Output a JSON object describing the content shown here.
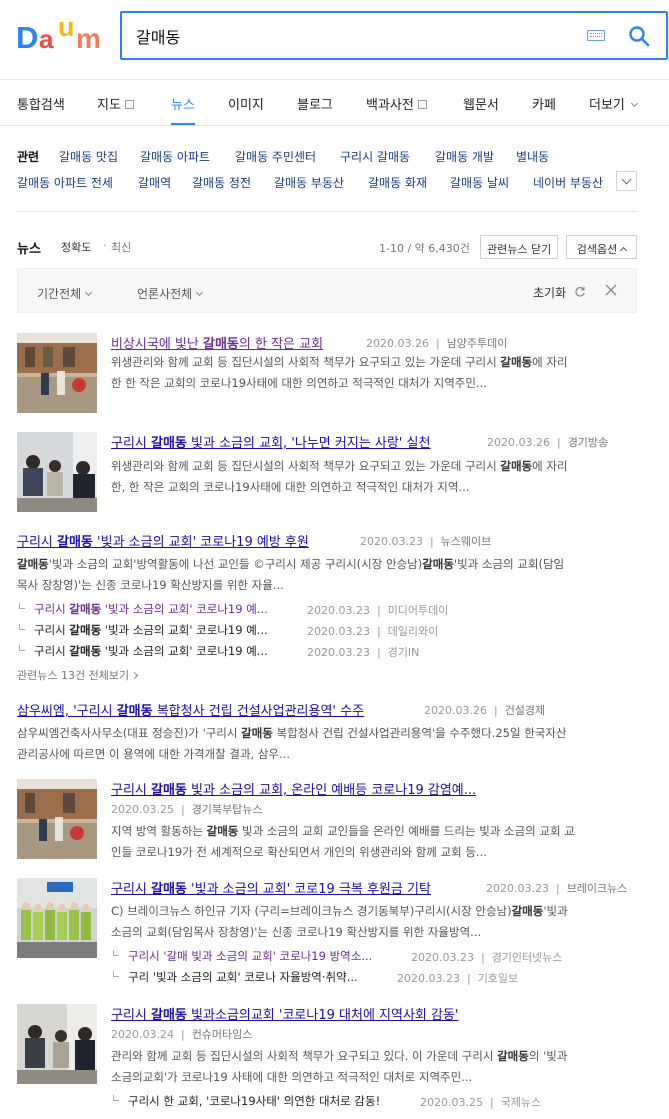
{
  "header": {
    "logo": {
      "letters": [
        "D",
        "a",
        "u",
        "m"
      ],
      "colors": [
        "#2c82f2",
        "#ef4b3f",
        "#f6b81b",
        "#f27c5a"
      ]
    },
    "search": {
      "value": "갈매동",
      "placeholder": ""
    }
  },
  "tabs": [
    {
      "label": "통합검색"
    },
    {
      "label": "지도"
    },
    {
      "label": "뉴스",
      "active": true
    },
    {
      "label": "이미지"
    },
    {
      "label": "블로그"
    },
    {
      "label": "백과사전"
    },
    {
      "label": "웹문서"
    },
    {
      "label": "카페"
    },
    {
      "label": "더보기"
    }
  ],
  "related": {
    "label": "관련",
    "keywords": [
      "갈매동 맛집",
      "갈매동 아파트",
      "갈매동 주민센터",
      "구리시 갈매동",
      "갈매동 개발",
      "별내동",
      "갈매동 아파트 전세",
      "갈매역",
      "갈매동 정전",
      "갈매동 부동산",
      "갈매동 화재",
      "갈매동 날씨",
      "네이버 부동산"
    ]
  },
  "news_head": {
    "title": "뉴스",
    "sort_accuracy": "정확도",
    "sort_dot": "·",
    "sort_recent": "최신",
    "count": "1-10 / 약 6,430건",
    "close_related_btn": "관련뉴스 닫기",
    "search_options_btn": "검색옵션"
  },
  "filter": {
    "period": "기간전체",
    "press": "언론사전체",
    "reset": "초기화"
  },
  "items": [
    {
      "title_pre": "비상시국에 빛난 ",
      "title_kw": "갈매동",
      "title_post": "의 한 작은 교회",
      "date": "2020.03.26",
      "source": "남양주투데이",
      "desc1_pre": "위생관리와 함께 교회 등 집단시설의 사회적 책무가 요구되고 있는 가운데 구리시 ",
      "desc1_kw": "갈매동",
      "desc1_post": "에 자리",
      "desc2": "한 한 작은 교회의 코로나19사태에 대한 의연하고 적극적인 대처가 지역주민..."
    },
    {
      "title_pre": "구리시 ",
      "title_kw": "갈매동",
      "title_post": " 빛과 소금의 교회, '나누면 커지는 사랑' 실천",
      "date": "2020.03.26",
      "source": "경기방송",
      "desc1_pre": "위생관리와 함께 교회 등 집단시설의 사회적 책무가 요구되고 있는 가운데 구리시 ",
      "desc1_kw": "갈매동",
      "desc1_post": "에 자리",
      "desc2": "한, 한 작은 교회의 코로나19사태에 대한 의연하고 적극적인 대처가 지역..."
    },
    {
      "title_pre": "구리시 ",
      "title_kw": "갈매동",
      "title_post": " '빛과 소금의 교회' 코로나19 예방 후원",
      "date": "2020.03.23",
      "source": "뉴스웨이브",
      "desc1_kw0": "갈매동",
      "desc1_pre": "'빛과 소금의 교회'방역활동에 나선 교인들 ©구리시 제공 구리시(시장 안승남)",
      "desc1_kw": "갈매동",
      "desc1_post": "'빛과 소금의 교회(담임",
      "desc2": "목사 장창영)'는 신종 코로나19 확산방지를 위한 자율...",
      "subs": [
        {
          "pre": "구리시 ",
          "kw": "갈매동",
          "post": " '빛과 소금의 교회' 코로나19 예...",
          "date": "2020.03.23",
          "source": "미디어투데이"
        },
        {
          "pre": "구리시 ",
          "kw": "갈매동",
          "post": " '빛과 소금의 교회' 코로나19 예...",
          "date": "2020.03.23",
          "source": "데일리와이"
        },
        {
          "pre": "구리시 ",
          "kw": "갈매동",
          "post": " '빛과 소금의 교회' 코로나19 예...",
          "date": "2020.03.23",
          "source": "경기IN"
        }
      ],
      "related_all": "관련뉴스 13건 전체보기"
    },
    {
      "title_pre": "삼우씨엠, '구리시 ",
      "title_kw": "갈매동",
      "title_post": " 복합청사 건립 건설사업관리용역' 수주",
      "date": "2020.03.26",
      "source": "건설경제",
      "desc1_pre": "삼우씨엠건축사사무소(대표 정승진)가 '구리시 ",
      "desc1_kw": "갈매동",
      "desc1_post": " 복합청사 건립 건설사업관리용역'을 수주했다.25일 한국자산",
      "desc2": "관리공사에 따르면 이 용역에 대한 가격개찰 결과, 삼우..."
    },
    {
      "title_pre": "구리시 ",
      "title_kw": "갈매동",
      "title_post": " 빛과 소금의 교회, 온라인 예배등 코로나19 감염예...",
      "date": "2020.03.25",
      "source": "경기북부탑뉴스",
      "desc1_pre": "지역 방역 활동하는 ",
      "desc1_kw": "갈매동",
      "desc1_post": " 빛과 소금의 교회 교인들을 온라인 예배를 드리는 빛과 소금의 교회 교",
      "desc2": "인들 코로나19가 전 세계적으로 확산되면서 개인의 위생관리와 함께 교회 등..."
    },
    {
      "title_pre": "구리시 ",
      "title_kw": "갈매동",
      "title_post": " '빛과 소금의 교회' 코로19 극복 후원금 기탁",
      "date": "2020.03.23",
      "source": "브레이크뉴스",
      "desc1_pre": "C) 브레이크뉴스 하인규 기자 (구리=브레이크뉴스 경기동북부)구리시(시장 안승남)",
      "desc1_kw": "갈매동",
      "desc1_post": "'빛과",
      "desc2": "소금의 교회(담임목사 장창영)'는 신종 코로나19 확산방지를 위한 자율방역...",
      "subs": [
        {
          "pre": "구리시 '갈매 빛과 소금의 교회' 코로나19 방역소...",
          "kw": "",
          "post": "",
          "date": "2020.03.23",
          "source": "경기인터넷뉴스"
        },
        {
          "pre": "구리 '빛과 소금의 교회' 코로나 자율방역·취약...",
          "kw": "",
          "post": "",
          "date": "2020.03.23",
          "source": "기호일보"
        }
      ]
    },
    {
      "title_pre": "구리시 ",
      "title_kw": "갈매동",
      "title_post": " 빛과소금의교회 '코로나19 대처에 지역사회 감동'",
      "date": "2020.03.24",
      "source": "컨슈머타임스",
      "desc1_pre": "관리와 함께 교회 등 집단시설의 사회적 책무가 요구되고 있다. 이 가운데 구리시 ",
      "desc1_kw": "갈매동",
      "desc1_post": "의 '빛과",
      "desc2": "소금의교회'가 코로나19 사태에 대한 의연하고 적극적인 대처로 지역주민...",
      "subs": [
        {
          "pre": "구리시 한 교회, '코로나19사태' 의연한 대처로 감동!",
          "kw": "",
          "post": "",
          "date": "2020.03.25",
          "source": "국제뉴스"
        }
      ]
    }
  ]
}
